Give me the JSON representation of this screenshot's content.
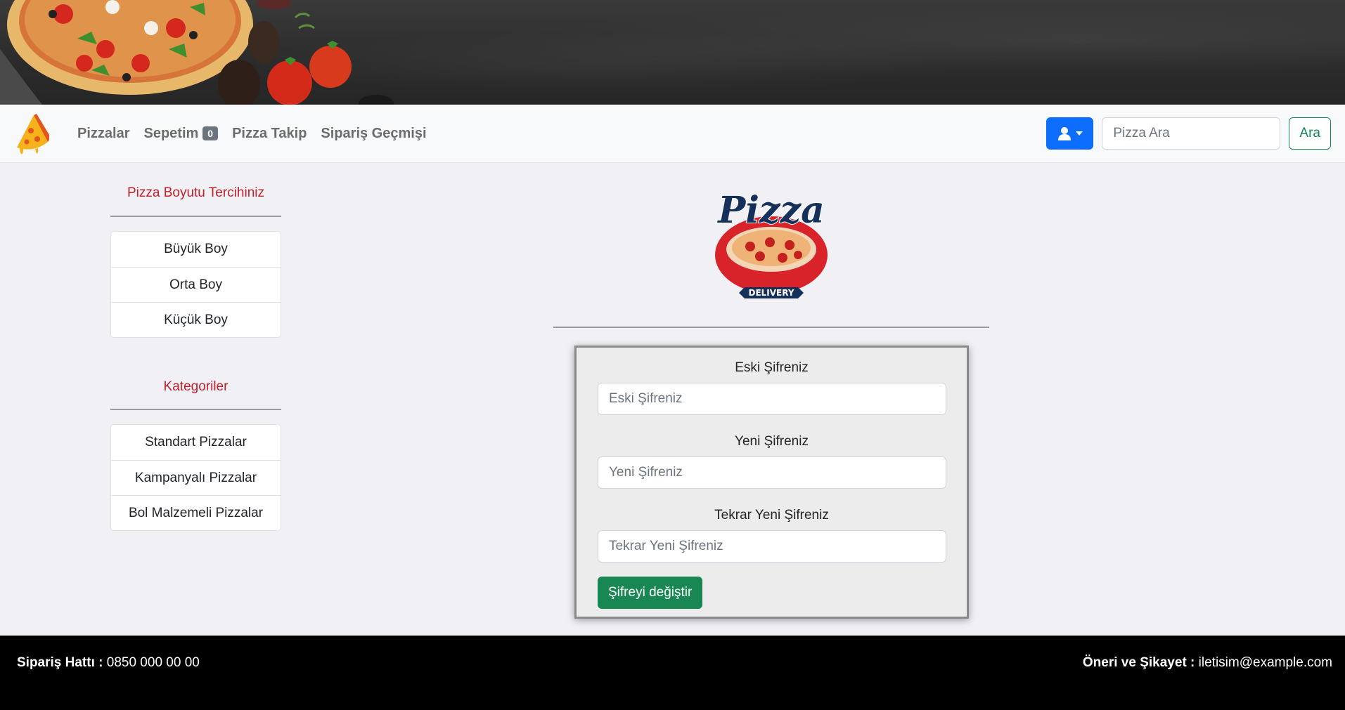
{
  "navbar": {
    "links": [
      "Pizzalar",
      "Sepetim",
      "Pizza Takip",
      "Sipariş Geçmişi"
    ],
    "cart_count": "0",
    "search_placeholder": "Pizza Ara",
    "search_button": "Ara"
  },
  "sidebar": {
    "size_heading": "Pizza Boyutu Tercihiniz",
    "sizes": [
      "Büyük Boy",
      "Orta Boy",
      "Küçük Boy"
    ],
    "category_heading": "Kategoriler",
    "categories": [
      "Standart Pizzalar",
      "Kampanyalı Pizzalar",
      "Bol Malzemeli Pizzalar"
    ]
  },
  "logo": {
    "title": "Pizza",
    "tagline": "DELIVERY"
  },
  "form": {
    "old_label": "Eski Şifreniz",
    "old_placeholder": "Eski Şifreniz",
    "new_label": "Yeni Şifreniz",
    "new_placeholder": "Yeni Şifreniz",
    "repeat_label": "Tekrar Yeni Şifreniz",
    "repeat_placeholder": "Tekrar Yeni Şifreniz",
    "submit": "Şifreyi değiştir"
  },
  "footer": {
    "phone_label": "Sipariş Hattı :",
    "phone": "0850 000 00 00",
    "feedback_label": "Öneri ve Şikayet :",
    "email": "iletisim@example.com"
  },
  "colors": {
    "primary": "#0d6efd",
    "success": "#198754",
    "heading_red": "#c0202b",
    "footer_bg": "#000000"
  }
}
